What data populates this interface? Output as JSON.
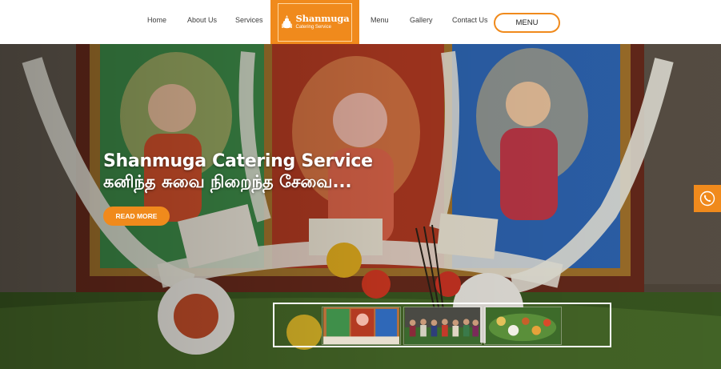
{
  "nav": {
    "items": [
      {
        "label": "Home"
      },
      {
        "label": "About Us"
      },
      {
        "label": "Services"
      },
      {
        "label": "Menu"
      },
      {
        "label": "Gallery"
      },
      {
        "label": "Contact Us"
      }
    ],
    "menu_button": "MENU"
  },
  "logo": {
    "title": "Shanmuga",
    "subtitle": "Catering Service"
  },
  "hero": {
    "title": "Shanmuga Catering Service",
    "tagline": "கனிந்த சுவை நிறைந்த சேவை...",
    "cta": "READ MORE"
  },
  "colors": {
    "accent": "#f08a1c",
    "header_bg": "#ffffff",
    "text": "#3c3c3c"
  },
  "floating": {
    "phone_icon": "phone-icon"
  },
  "thumbnails": [
    {
      "name": "ganesha-altar-thumbnail"
    },
    {
      "name": "group-photo-thumbnail"
    },
    {
      "name": "banana-leaf-meal-thumbnail"
    }
  ]
}
